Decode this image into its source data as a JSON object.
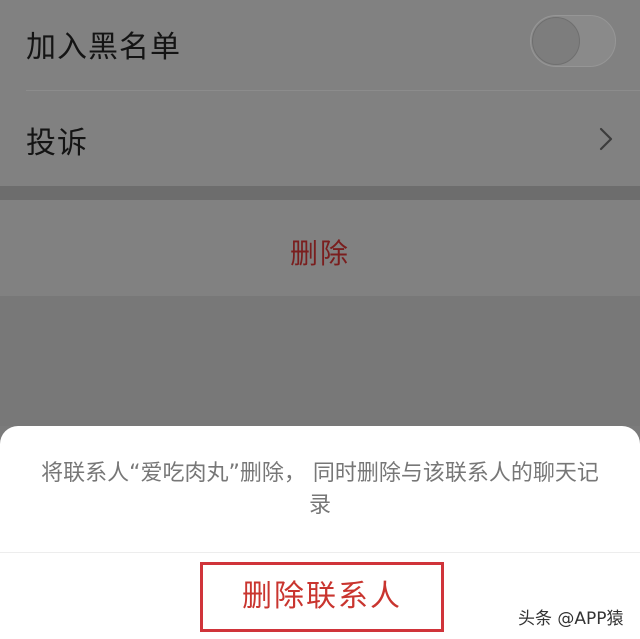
{
  "settings": {
    "blacklist_label": "加入黑名单",
    "blacklist_enabled": false,
    "complaint_label": "投诉",
    "delete_label": "删除"
  },
  "sheet": {
    "message": "将联系人“爱吃肉丸”删除， 同时删除与该联系人的聊天记录",
    "confirm_label": "删除联系人"
  },
  "watermark": "头条 @APP猿",
  "colors": {
    "delete_text": "#7a1e1e",
    "confirm_text": "#c9352f",
    "confirm_border": "#d0343a"
  },
  "icons": {
    "complaint_chevron": "chevron-right-icon",
    "blacklist_toggle": "toggle-switch-off"
  }
}
